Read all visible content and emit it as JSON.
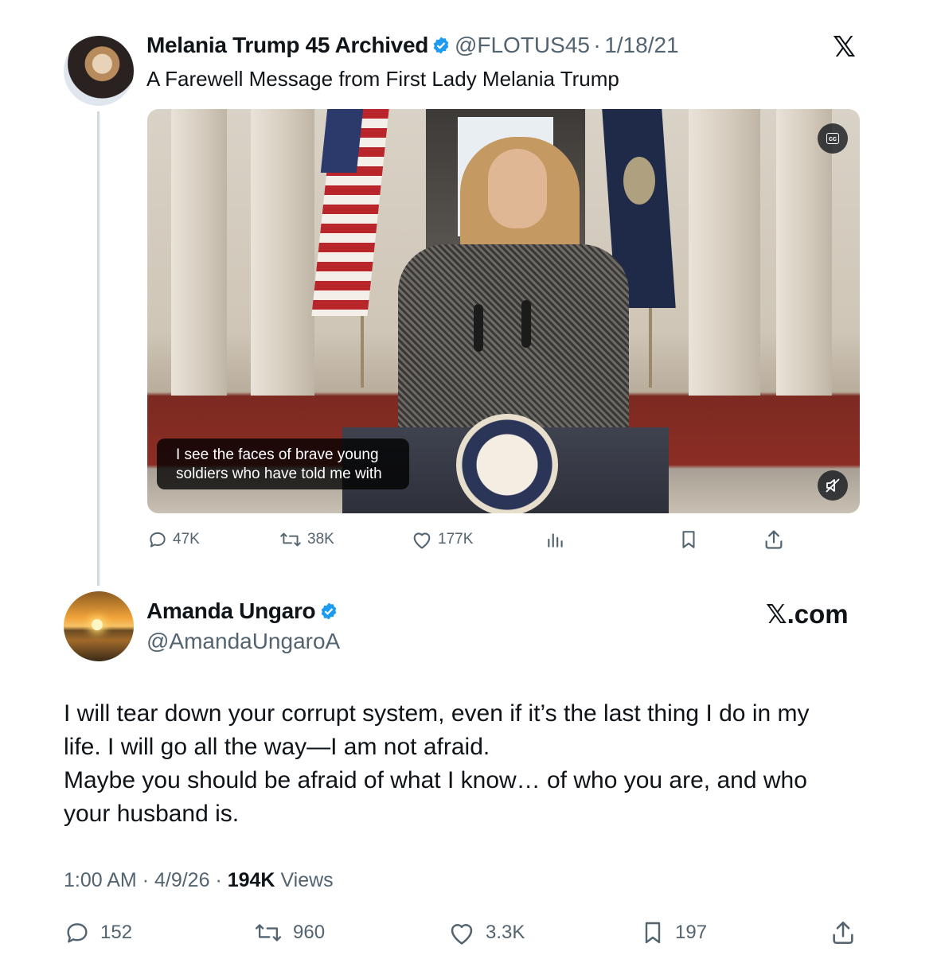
{
  "quoted_post": {
    "author_name": "Melania Trump 45 Archived",
    "handle": "@FLOTUS45",
    "separator": "·",
    "date": "1/18/21",
    "text": "A Farewell Message from First Lady Melania Trump",
    "video": {
      "caption_line_1": "I see the faces of brave young",
      "caption_line_2": "soldiers who have told me with",
      "cc_label": "cc"
    },
    "stats": {
      "replies": "47K",
      "reposts": "38K",
      "likes": "177K"
    },
    "x_logo": "𝕏"
  },
  "main_post": {
    "author_name": "Amanda Ungaro",
    "handle": "@AmandaUngaroA",
    "brand": "𝕏.com",
    "text_lines": [
      "I will tear down your corrupt system, even if it’s the last thing I do in my",
      "life. I will go all the way—I am not afraid.",
      "Maybe you should be afraid of what I know… of who you are, and who",
      "your husband is."
    ],
    "time": "1:00 AM",
    "date": "4/9/26",
    "separator": "·",
    "views_count": "194K",
    "views_label": "Views",
    "stats": {
      "replies": "152",
      "reposts": "960",
      "likes": "3.3K",
      "bookmarks": "197"
    }
  },
  "colors": {
    "verified_blue": "#1d9bf0",
    "secondary_text": "#536471",
    "primary_text": "#0f1419",
    "thread_line": "#cfd9de"
  }
}
